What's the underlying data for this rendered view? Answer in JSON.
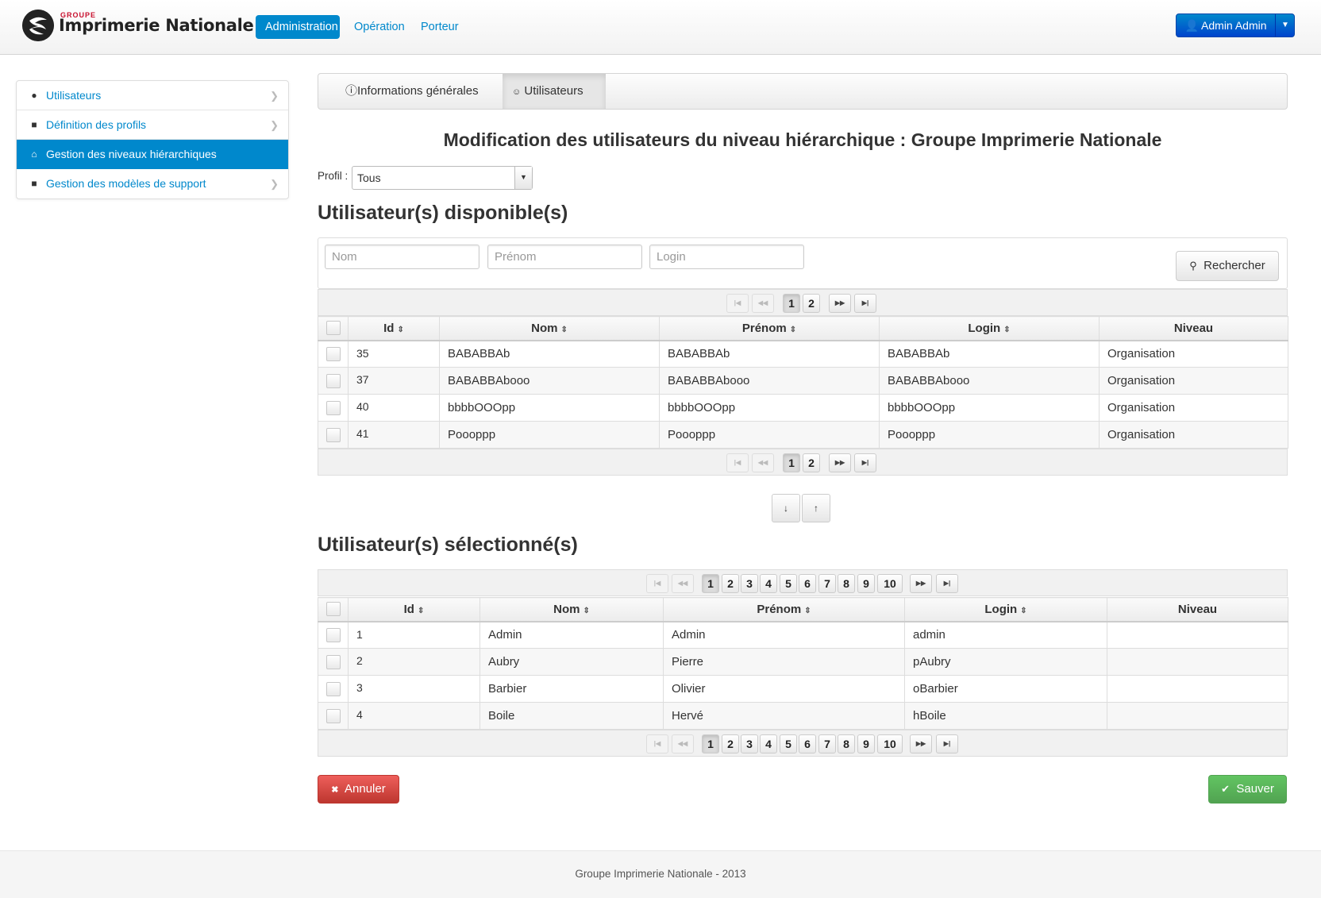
{
  "brand": {
    "groupe": "GROUPE",
    "name": "Imprimerie Nationale"
  },
  "nav": {
    "items": [
      "Administration",
      "Opération",
      "Porteur"
    ]
  },
  "user": {
    "label": "Admin Admin"
  },
  "sidebar": {
    "items": [
      {
        "label": "Utilisateurs",
        "icon": "user-icon"
      },
      {
        "label": "Définition des profils",
        "icon": "lock-icon"
      },
      {
        "label": "Gestion des niveaux hiérarchiques",
        "icon": "home-icon"
      },
      {
        "label": "Gestion des modèles de support",
        "icon": "lock-icon"
      }
    ]
  },
  "tabs": [
    "Informations générales",
    "Utilisateurs"
  ],
  "page_title": "Modification des utilisateurs du niveau hiérarchique : Groupe Imprimerie Nationale",
  "profil": {
    "label": "Profil :",
    "value": "Tous"
  },
  "available": {
    "title": "Utilisateur(s) disponible(s)",
    "search": {
      "nom": "Nom",
      "prenom": "Prénom",
      "login": "Login",
      "button": "Rechercher"
    },
    "pages": [
      "1",
      "2"
    ],
    "headers": {
      "id": "Id",
      "nom": "Nom",
      "prenom": "Prénom",
      "login": "Login",
      "niveau": "Niveau"
    },
    "rows": [
      {
        "id": "35",
        "nom": "BABABBAb",
        "prenom": "BABABBAb",
        "login": "BABABBAb",
        "niveau": "Organisation"
      },
      {
        "id": "37",
        "nom": "BABABBAbooo",
        "prenom": "BABABBAbooo",
        "login": "BABABBAbooo",
        "niveau": "Organisation"
      },
      {
        "id": "40",
        "nom": "bbbbOOOpp",
        "prenom": "bbbbOOOpp",
        "login": "bbbbOOOpp",
        "niveau": "Organisation"
      },
      {
        "id": "41",
        "nom": "Poooppp",
        "prenom": "Poooppp",
        "login": "Poooppp",
        "niveau": "Organisation"
      }
    ]
  },
  "selected": {
    "title": "Utilisateur(s) sélectionné(s)",
    "pages": [
      "1",
      "2",
      "3",
      "4",
      "5",
      "6",
      "7",
      "8",
      "9",
      "10"
    ],
    "headers": {
      "id": "Id",
      "nom": "Nom",
      "prenom": "Prénom",
      "login": "Login",
      "niveau": "Niveau"
    },
    "rows": [
      {
        "id": "1",
        "nom": "Admin",
        "prenom": "Admin",
        "login": "admin",
        "niveau": ""
      },
      {
        "id": "2",
        "nom": "Aubry",
        "prenom": "Pierre",
        "login": "pAubry",
        "niveau": ""
      },
      {
        "id": "3",
        "nom": "Barbier",
        "prenom": "Olivier",
        "login": "oBarbier",
        "niveau": ""
      },
      {
        "id": "4",
        "nom": "Boile",
        "prenom": "Hervé",
        "login": "hBoile",
        "niveau": ""
      }
    ]
  },
  "actions": {
    "cancel": "Annuler",
    "save": "Sauver"
  },
  "footer": "Groupe Imprimerie Nationale - 2013",
  "colors": {
    "primary": "#0088cc",
    "danger": "#bd362f",
    "success": "#51a351"
  }
}
